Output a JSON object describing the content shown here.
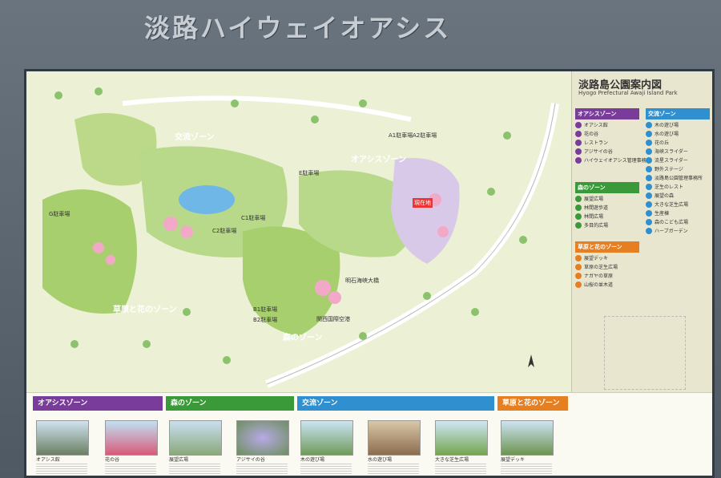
{
  "sign_title": "淡路ハイウェイオアシス",
  "legend": {
    "title": "淡路島公園案内図",
    "subtitle": "Hyogo Prefectural Awaji Island Park",
    "groups": [
      {
        "name": "オアシスゾーン",
        "color": "#7a3c9a",
        "items": [
          "オアシス館",
          "花の谷",
          "レストラン",
          "アジサイの谷",
          "ハイウェイオアシス管理事務所"
        ]
      },
      {
        "name": "交流ゾーン",
        "color": "#2f8fcf",
        "items": [
          "木の遊び場",
          "水の遊び場",
          "花の丘",
          "海峡スライダー",
          "流星スライダー",
          "野外ステージ",
          "淡路島公園管理事務所",
          "芝生のレスト",
          "展望の森",
          "大きな芝生広場",
          "生産棟",
          "森のこども広場",
          "ハーブガーデン"
        ]
      },
      {
        "name": "森のゾーン",
        "color": "#3a9a3a",
        "items": [
          "展望広場",
          "林間遊歩道",
          "林間広場",
          "多目的広場"
        ]
      },
      {
        "name": "草原と花のゾーン",
        "color": "#e67e22",
        "items": [
          "展望デッキ",
          "草原の芝生広場",
          "ナガヤの草原",
          "山桜の並木道"
        ]
      }
    ]
  },
  "map": {
    "zones": [
      {
        "label": "交流ゾーン",
        "color": "#2f8fcf"
      },
      {
        "label": "オアシスゾーン",
        "color": "#7a3c9a"
      },
      {
        "label": "森のゾーン",
        "color": "#3a9a3a"
      },
      {
        "label": "草原と花のゾーン",
        "color": "#e67e22"
      }
    ],
    "pins": [
      "現在地",
      "A1駐車場",
      "A2駐車場",
      "B1駐車場",
      "B2駐車場",
      "C1駐車場",
      "C2駐車場",
      "E駐車場",
      "G駐車場",
      "明石海峡大橋",
      "関西国際空港"
    ]
  },
  "bottom_panels": [
    {
      "title": "オアシスゾーン",
      "color": "#7a3c9a",
      "photos": [
        "オアシス館",
        "花の谷"
      ]
    },
    {
      "title": "森のゾーン",
      "color": "#3a9a3a",
      "photos": [
        "展望広場",
        "アジサイの谷"
      ]
    },
    {
      "title": "交流ゾーン",
      "color": "#2f8fcf",
      "photos": [
        "木の遊び場",
        "水の遊び場",
        "大きな芝生広場"
      ]
    },
    {
      "title": "草原と花のゾーン",
      "color": "#e67e22",
      "photos": [
        "展望デッキ"
      ]
    }
  ]
}
